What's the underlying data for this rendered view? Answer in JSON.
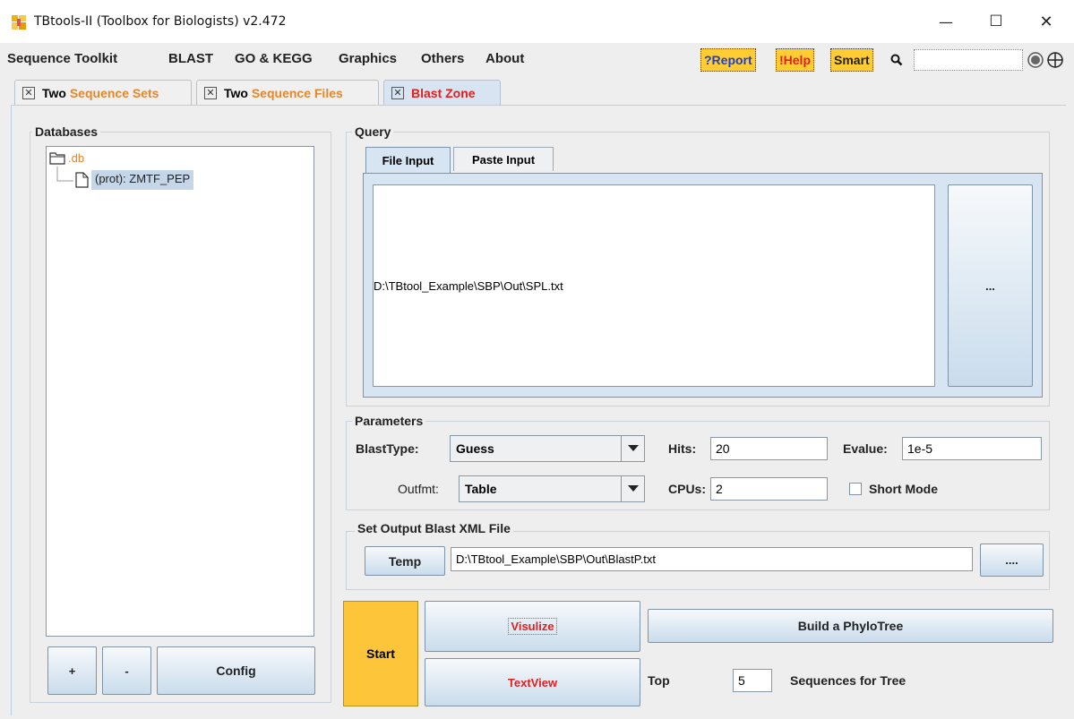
{
  "window": {
    "title": "TBtools-II (Toolbox for Biologists) v2.472",
    "minimize_glyph": "—",
    "maximize_glyph": "☐",
    "close_glyph": "✕"
  },
  "menu": {
    "items": [
      "Sequence Toolkit",
      "BLAST",
      "GO & KEGG",
      "Graphics",
      "Others",
      "About"
    ],
    "report": "?Report",
    "help": "!Help",
    "smart": "Smart",
    "search_value": ""
  },
  "tabs": [
    {
      "prefix": "Two ",
      "suffix": "Sequence Sets"
    },
    {
      "prefix": "Two ",
      "suffix": "Sequence Files"
    },
    {
      "prefix": "",
      "suffix": "Blast Zone"
    }
  ],
  "databases": {
    "title": "Databases",
    "root": ".db",
    "child": "(prot): ZMTF_PEP",
    "add_label": "+",
    "remove_label": "-",
    "config_label": "Config"
  },
  "query": {
    "title": "Query",
    "tab_file": "File Input",
    "tab_paste": "Paste Input",
    "file_path": "D:\\TBtool_Example\\SBP\\Out\\SPL.txt",
    "browse_label": "..."
  },
  "parameters": {
    "title": "Parameters",
    "blasttype_label": "BlastType:",
    "blasttype_value": "Guess",
    "hits_label": "Hits:",
    "hits_value": "20",
    "evalue_label": "Evalue:",
    "evalue_value": "1e-5",
    "outfmt_label": "Outfmt:",
    "outfmt_value": "Table",
    "cpus_label": "CPUs:",
    "cpus_value": "2",
    "short_mode_label": "Short Mode"
  },
  "output": {
    "title": "Set Output Blast XML File",
    "temp_label": "Temp",
    "path": "D:\\TBtool_Example\\SBP\\Out\\BlastP.txt",
    "browse_label": "...."
  },
  "actions": {
    "start": "Start",
    "visulize": "Visulize",
    "textview": "TextView",
    "build_tree": "Build a PhyloTree",
    "top_label": "Top",
    "top_value": "5",
    "seq_for_tree": "Sequences for Tree"
  },
  "colors": {
    "accent_orange": "#e8862a",
    "red": "#e02020",
    "start_yellow": "#fdc53a",
    "selection_blue": "#c5d6e8"
  }
}
